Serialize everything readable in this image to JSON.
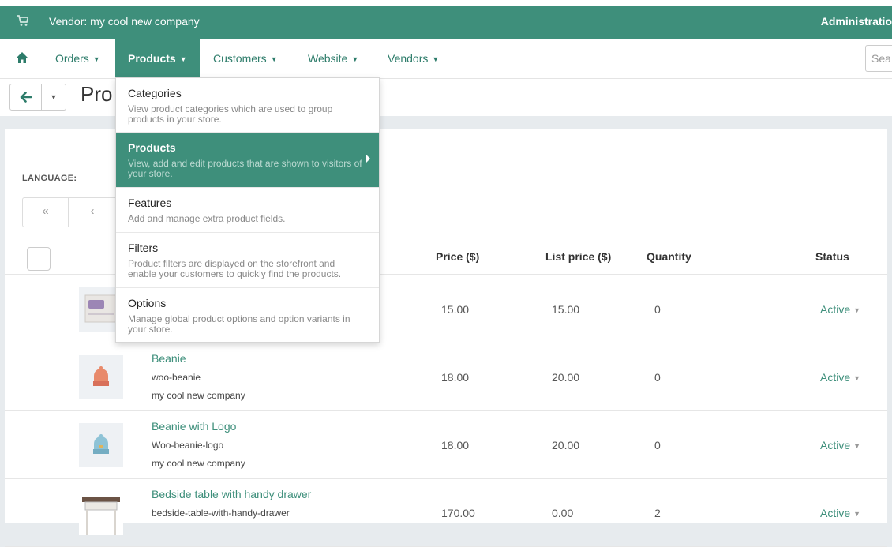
{
  "topbar": {
    "vendor": "Vendor: my cool new company",
    "admin": "Administratio"
  },
  "nav": {
    "items": [
      {
        "label": "Orders"
      },
      {
        "label": "Products"
      },
      {
        "label": "Customers"
      },
      {
        "label": "Website"
      },
      {
        "label": "Vendors"
      }
    ],
    "search_placeholder": "Sea"
  },
  "header": {
    "title": "Pro"
  },
  "language_label": "LANGUAGE:",
  "pager": {
    "first": "«",
    "prev": "‹"
  },
  "table": {
    "headers": {
      "price": "Price ($)",
      "list_price": "List price ($)",
      "quantity": "Quantity",
      "status": "Status"
    },
    "rows": [
      {
        "name": "",
        "code": "",
        "vendor": "",
        "price": "15.00",
        "list_price": "15.00",
        "quantity": "0",
        "status": "Active"
      },
      {
        "name": "Beanie",
        "code": "woo-beanie",
        "vendor": "my cool new company",
        "price": "18.00",
        "list_price": "20.00",
        "quantity": "0",
        "status": "Active"
      },
      {
        "name": "Beanie with Logo",
        "code": "Woo-beanie-logo",
        "vendor": "my cool new company",
        "price": "18.00",
        "list_price": "20.00",
        "quantity": "0",
        "status": "Active"
      },
      {
        "name": "Bedside table with handy drawer",
        "code": "bedside-table-with-handy-drawer",
        "vendor": "",
        "price": "170.00",
        "list_price": "0.00",
        "quantity": "2",
        "status": "Active"
      }
    ]
  },
  "menu": {
    "items": [
      {
        "title": "Categories",
        "desc": "View product categories which are used to group products in your store."
      },
      {
        "title": "Products",
        "desc": "View, add and edit products that are shown to visitors of your store."
      },
      {
        "title": "Features",
        "desc": "Add and manage extra product fields."
      },
      {
        "title": "Filters",
        "desc": "Product filters are displayed on the storefront and enable your customers to quickly find the products."
      },
      {
        "title": "Options",
        "desc": "Manage global product options and option variants in your store."
      }
    ]
  },
  "colors": {
    "accent": "#3e8f7b",
    "background": "#e7ebee"
  }
}
